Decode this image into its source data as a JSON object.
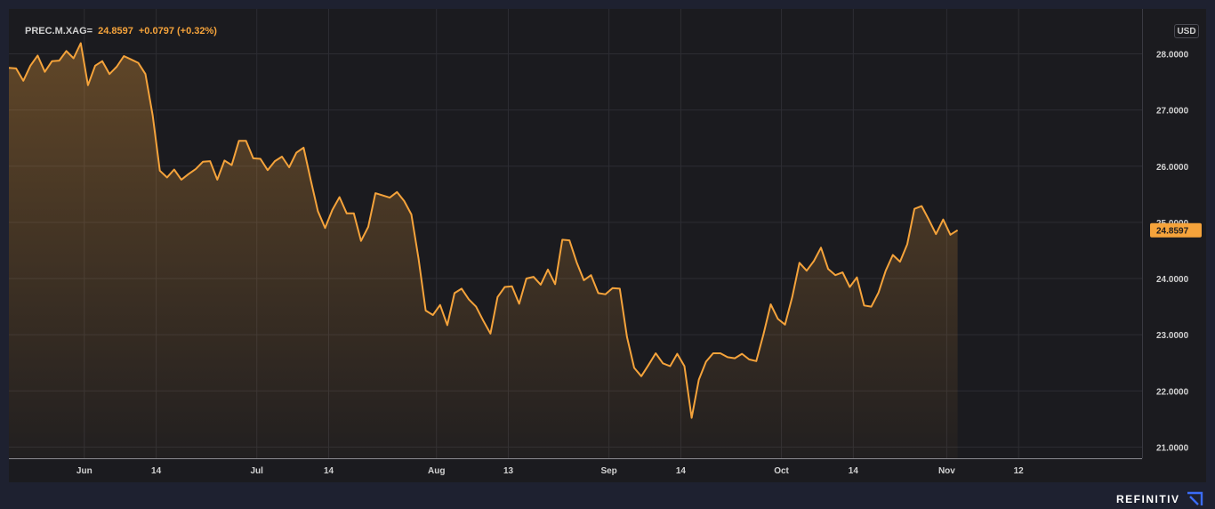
{
  "header": {
    "symbol": "PREC.M.XAG=",
    "last_value": "24.8597",
    "change": "+0.0797 (+0.32%)"
  },
  "currency_badge": "USD",
  "brand": "REFINITIV",
  "colors": {
    "line": "#f5a33b",
    "background": "#1b1b1f",
    "grid": "#2d2d33",
    "page": "#1e2130",
    "last_label_bg": "#f5a33b"
  },
  "chart_data": {
    "type": "area",
    "title": "",
    "xlabel": "",
    "ylabel": "",
    "ylim": [
      20.8,
      28.8
    ],
    "y_ticks": [
      "21.0000",
      "22.0000",
      "23.0000",
      "24.0000",
      "25.0000",
      "26.0000",
      "27.0000",
      "28.0000"
    ],
    "x_ticks": [
      {
        "label": "Jun",
        "index": 10
      },
      {
        "label": "14",
        "index": 20
      },
      {
        "label": "Jul",
        "index": 34
      },
      {
        "label": "14",
        "index": 44
      },
      {
        "label": "Aug",
        "index": 59
      },
      {
        "label": "13",
        "index": 69
      },
      {
        "label": "Sep",
        "index": 83
      },
      {
        "label": "14",
        "index": 93
      },
      {
        "label": "Oct",
        "index": 107
      },
      {
        "label": "14",
        "index": 117
      },
      {
        "label": "Nov",
        "index": 130
      },
      {
        "label": "12",
        "index": 140
      }
    ],
    "x_count": 156,
    "last_label": "24.8597",
    "grid": true,
    "series": [
      {
        "values": [
          27.75,
          27.74,
          27.52,
          27.79,
          27.97,
          27.68,
          27.87,
          27.88,
          28.05,
          27.92,
          28.19,
          27.44,
          27.79,
          27.87,
          27.64,
          27.77,
          27.96,
          27.9,
          27.84,
          27.64,
          26.91,
          25.92,
          25.8,
          25.94,
          25.76,
          25.86,
          25.95,
          26.08,
          26.09,
          25.76,
          26.1,
          26.02,
          26.45,
          26.45,
          26.14,
          26.13,
          25.93,
          26.09,
          26.17,
          25.98,
          26.24,
          26.33,
          25.75,
          25.2,
          24.9,
          25.22,
          25.45,
          25.16,
          25.16,
          24.67,
          24.92,
          25.52,
          25.48,
          25.44,
          25.54,
          25.38,
          25.14,
          24.35,
          23.43,
          23.35,
          23.53,
          23.17,
          23.74,
          23.82,
          23.63,
          23.5,
          23.25,
          23.02,
          23.67,
          23.85,
          23.86,
          23.55,
          24.0,
          24.03,
          23.89,
          24.16,
          23.9,
          24.69,
          24.68,
          24.29,
          23.97,
          24.06,
          23.74,
          23.72,
          23.83,
          23.82,
          22.96,
          22.41,
          22.26,
          22.46,
          22.67,
          22.49,
          22.44,
          22.66,
          22.44,
          21.52,
          22.2,
          22.52,
          22.67,
          22.67,
          22.6,
          22.58,
          22.66,
          22.56,
          22.53,
          23.01,
          23.54,
          23.28,
          23.18,
          23.67,
          24.28,
          24.14,
          24.31,
          24.55,
          24.17,
          24.06,
          24.11,
          23.85,
          24.02,
          23.52,
          23.5,
          23.75,
          24.14,
          24.42,
          24.3,
          24.61,
          25.24,
          25.29,
          25.05,
          24.79,
          25.05,
          24.78,
          24.86
        ]
      }
    ]
  }
}
